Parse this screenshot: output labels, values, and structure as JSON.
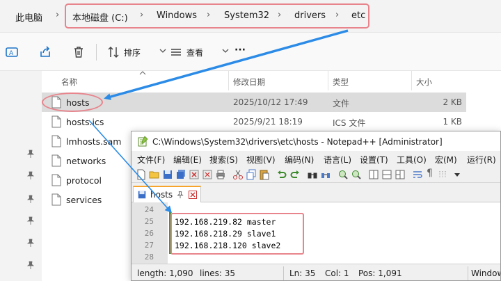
{
  "breadcrumb": {
    "root": "此电脑",
    "items": [
      "本地磁盘 (C:)",
      "Windows",
      "System32",
      "drivers",
      "etc"
    ],
    "separator": "›"
  },
  "toolbar": {
    "sort_label": "排序",
    "view_label": "查看",
    "more_label": "···"
  },
  "columns": {
    "name": "名称",
    "date": "修改日期",
    "type": "类型",
    "size": "大小"
  },
  "files": [
    {
      "name": "hosts",
      "date": "2025/10/12 17:49",
      "type": "文件",
      "size": "2 KB"
    },
    {
      "name": "hosts.ics",
      "date": "2025/9/21 18:19",
      "type": "ICS 文件",
      "size": "1 KB"
    },
    {
      "name": "lmhosts.sam"
    },
    {
      "name": "networks"
    },
    {
      "name": "protocol"
    },
    {
      "name": "services"
    }
  ],
  "notepad": {
    "title": "C:\\Windows\\System32\\drivers\\etc\\hosts - Notepad++ [Administrator]",
    "menu": [
      "文件(F)",
      "编辑(E)",
      "搜索(S)",
      "视图(V)",
      "编码(N)",
      "语言(L)",
      "设置(T)",
      "工具(O)",
      "宏(M)",
      "运行(R)"
    ],
    "tab_label": "hosts",
    "lines": [
      {
        "num": "24",
        "text": ""
      },
      {
        "num": "25",
        "text": "192.168.219.82 master"
      },
      {
        "num": "26",
        "text": "192.168.218.29 slave1"
      },
      {
        "num": "27",
        "text": "192.168.218.120 slave2"
      },
      {
        "num": "28",
        "text": ""
      }
    ],
    "status": {
      "length": "length: 1,090",
      "lines": "lines: 35",
      "ln": "Ln: 35",
      "col": "Col: 1",
      "pos": "Pos: 1,091",
      "eol": "Windows"
    }
  },
  "colors": {
    "highlight": "#e8848c",
    "arrow": "#2b8be6",
    "selection": "#dcdcdc"
  }
}
